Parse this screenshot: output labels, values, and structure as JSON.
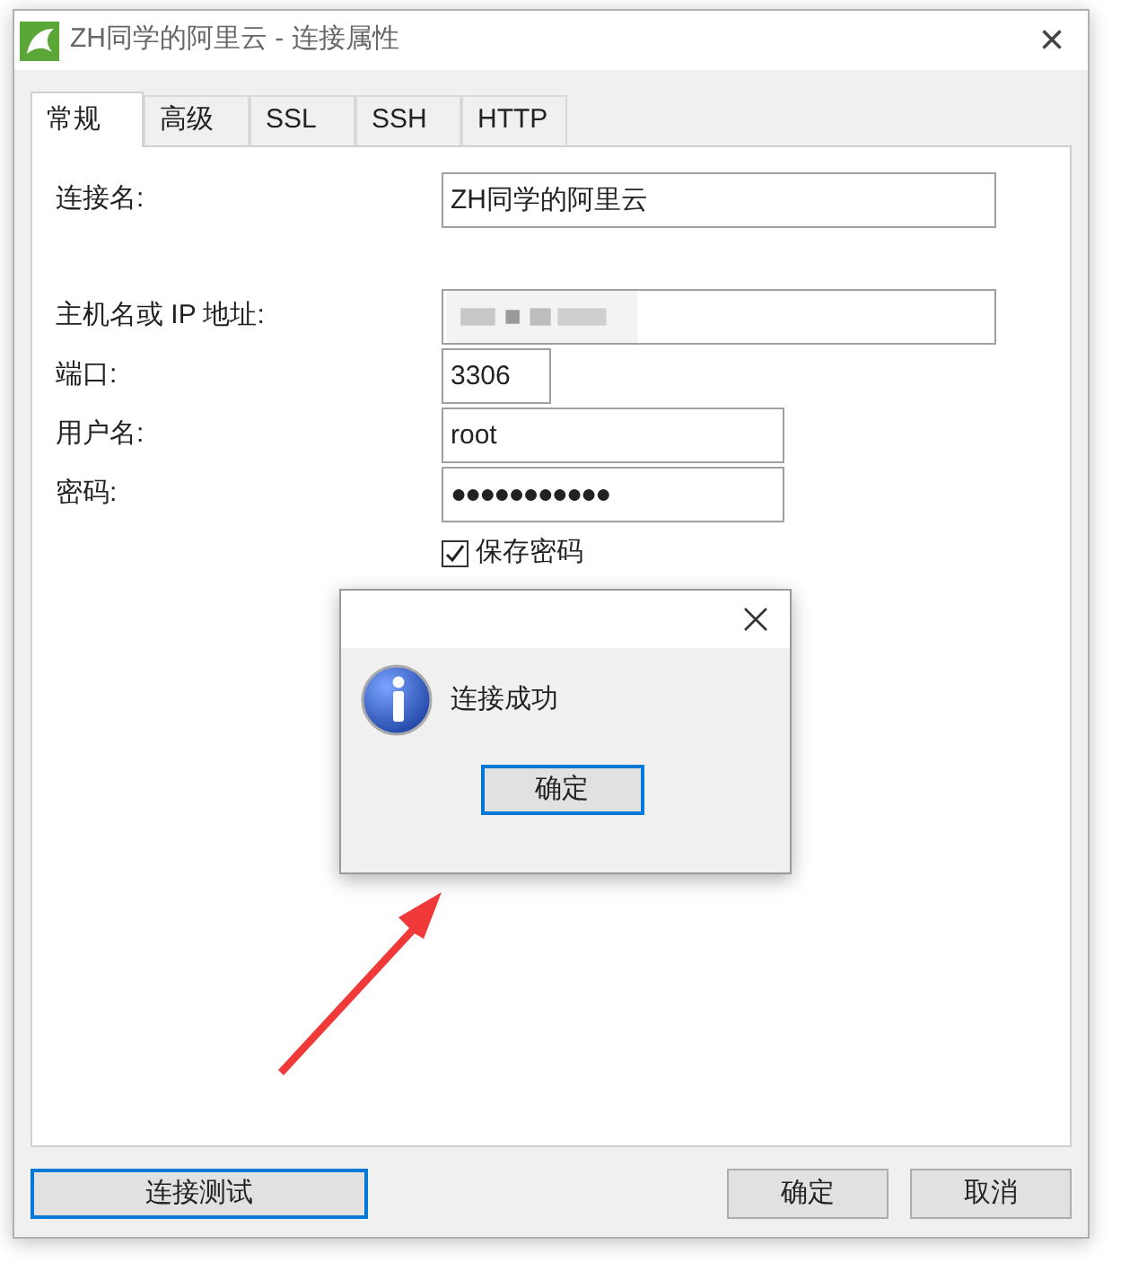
{
  "window": {
    "title": "ZH同学的阿里云 - 连接属性",
    "close": "×"
  },
  "tabs": [
    {
      "label": "常规",
      "selected": true
    },
    {
      "label": "高级",
      "selected": false
    },
    {
      "label": "SSL",
      "selected": false
    },
    {
      "label": "SSH",
      "selected": false
    },
    {
      "label": "HTTP",
      "selected": false
    }
  ],
  "fields": [
    {
      "kind": "text",
      "label": "连接名:",
      "value": "ZH同学的阿里云"
    },
    {
      "kind": "blurred",
      "label": "主机名或 IP 地址:"
    },
    {
      "kind": "text",
      "label": "端口:",
      "value": "3306"
    },
    {
      "kind": "text",
      "label": "用户名:",
      "value": "root"
    },
    {
      "kind": "password",
      "label": "密码:",
      "value": "●●●●●●●●●●●"
    }
  ],
  "save_password": {
    "label": "保存密码",
    "checked": true
  },
  "buttons": {
    "test": "连接测试",
    "ok": "确定",
    "cancel": "取消"
  },
  "message_box": {
    "text": "连接成功",
    "ok": "确定"
  }
}
